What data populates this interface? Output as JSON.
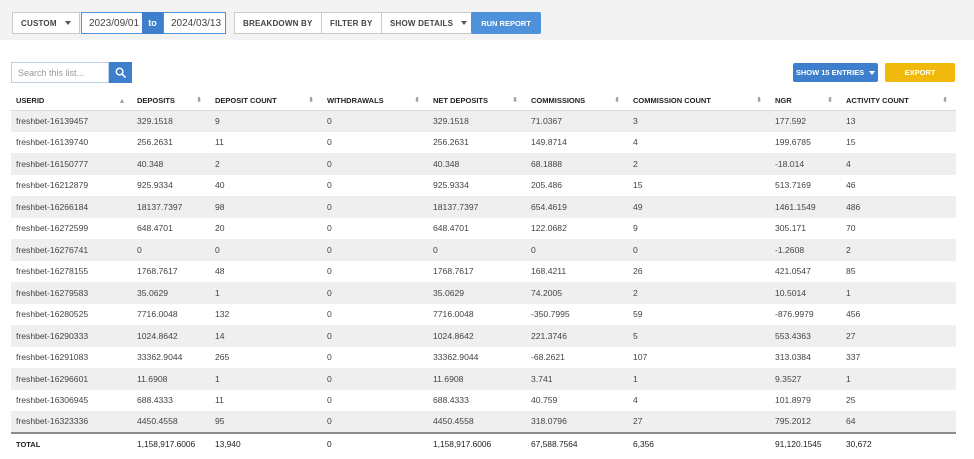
{
  "toolbar": {
    "custom_label": "CUSTOM",
    "date_from": "2023/09/01",
    "to_label": "to",
    "date_to": "2024/03/13",
    "breakdown_label": "BREAKDOWN BY",
    "filter_label": "FILTER BY",
    "show_details_label": "SHOW DETAILS",
    "run_label": "RUN REPORT"
  },
  "search": {
    "placeholder": "Search this list..."
  },
  "actions": {
    "show_entries_label": "SHOW 15 ENTRIES",
    "export_label": "EXPORT"
  },
  "colors": {
    "accent": "#3d7fcc",
    "export": "#f0b90b",
    "stripe": "#efefef"
  },
  "table": {
    "headers": [
      "USERID",
      "DEPOSITS",
      "DEPOSIT COUNT",
      "WITHDRAWALS",
      "NET DEPOSITS",
      "COMMISSIONS",
      "COMMISSION COUNT",
      "NGR",
      "ACTIVITY COUNT"
    ],
    "rows": [
      [
        "freshbet-16139457",
        "329.1518",
        "9",
        "0",
        "329.1518",
        "71.0367",
        "3",
        "177.592",
        "13"
      ],
      [
        "freshbet-16139740",
        "256.2631",
        "11",
        "0",
        "256.2631",
        "149.8714",
        "4",
        "199.6785",
        "15"
      ],
      [
        "freshbet-16150777",
        "40.348",
        "2",
        "0",
        "40.348",
        "68.1888",
        "2",
        "-18.014",
        "4"
      ],
      [
        "freshbet-16212879",
        "925.9334",
        "40",
        "0",
        "925.9334",
        "205.486",
        "15",
        "513.7169",
        "46"
      ],
      [
        "freshbet-16266184",
        "18137.7397",
        "98",
        "0",
        "18137.7397",
        "654.4619",
        "49",
        "1461.1549",
        "486"
      ],
      [
        "freshbet-16272599",
        "648.4701",
        "20",
        "0",
        "648.4701",
        "122.0682",
        "9",
        "305.171",
        "70"
      ],
      [
        "freshbet-16276741",
        "0",
        "0",
        "0",
        "0",
        "0",
        "0",
        "-1.2608",
        "2"
      ],
      [
        "freshbet-16278155",
        "1768.7617",
        "48",
        "0",
        "1768.7617",
        "168.4211",
        "26",
        "421.0547",
        "85"
      ],
      [
        "freshbet-16279583",
        "35.0629",
        "1",
        "0",
        "35.0629",
        "74.2005",
        "2",
        "10.5014",
        "1"
      ],
      [
        "freshbet-16280525",
        "7716.0048",
        "132",
        "0",
        "7716.0048",
        "-350.7995",
        "59",
        "-876.9979",
        "456"
      ],
      [
        "freshbet-16290333",
        "1024.8642",
        "14",
        "0",
        "1024.8642",
        "221.3746",
        "5",
        "553.4363",
        "27"
      ],
      [
        "freshbet-16291083",
        "33362.9044",
        "265",
        "0",
        "33362.9044",
        "-68.2621",
        "107",
        "313.0384",
        "337"
      ],
      [
        "freshbet-16296601",
        "11.6908",
        "1",
        "0",
        "11.6908",
        "3.741",
        "1",
        "9.3527",
        "1"
      ],
      [
        "freshbet-16306945",
        "688.4333",
        "11",
        "0",
        "688.4333",
        "40.759",
        "4",
        "101.8979",
        "25"
      ],
      [
        "freshbet-16323336",
        "4450.4558",
        "95",
        "0",
        "4450.4558",
        "318.0796",
        "27",
        "795.2012",
        "64"
      ]
    ],
    "totals": [
      "TOTAL",
      "1,158,917.6006",
      "13,940",
      "0",
      "1,158,917.6006",
      "67,588.7564",
      "6,356",
      "91,120.1545",
      "30,672"
    ]
  }
}
